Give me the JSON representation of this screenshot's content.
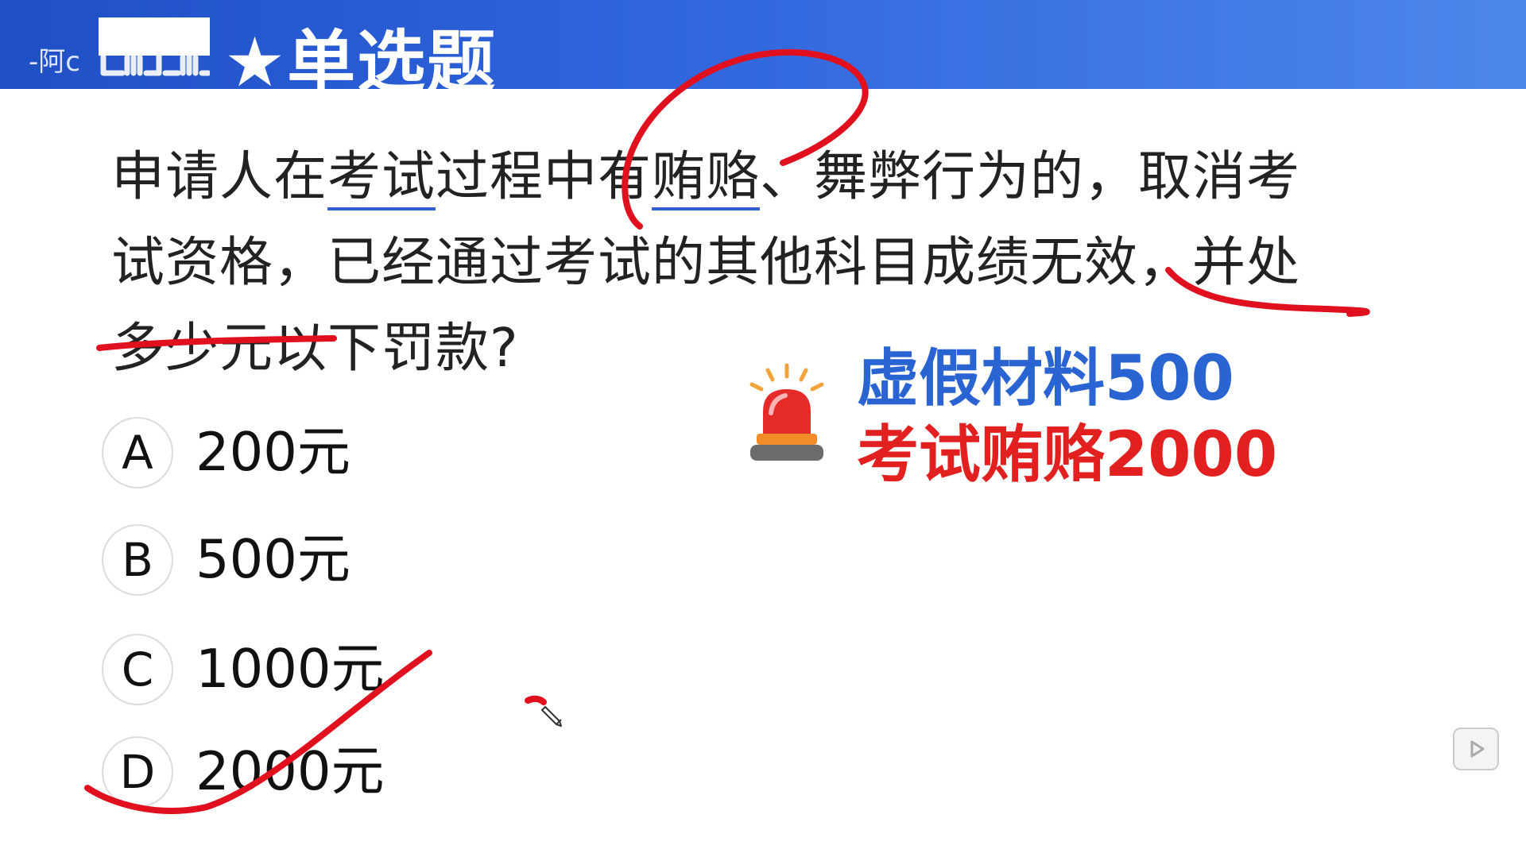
{
  "header": {
    "watermark_text": "-阿c",
    "title": "★单选题",
    "bg_color": "#2e63dc"
  },
  "question": {
    "line1_a": "申请人在",
    "line1_b": "考试",
    "line1_c": "过程中有",
    "line1_d": "贿赂",
    "line1_e": "、舞弊行为的，取消考",
    "line2": "试资格，已经通过考试的其他科目成绩无效，并处",
    "line3": "多少元以下罚款?"
  },
  "options": [
    {
      "letter": "A",
      "text": "200元"
    },
    {
      "letter": "B",
      "text": "500元"
    },
    {
      "letter": "C",
      "text": "1000元"
    },
    {
      "letter": "D",
      "text": "2000元"
    }
  ],
  "notes": {
    "line1": "虚假材料500",
    "line2": "考试贿赂2000"
  },
  "icons": {
    "alarm": "siren-icon",
    "pencil": "pencil-cursor-icon",
    "play": "play-icon"
  },
  "colors": {
    "annotation_red": "#e0101e",
    "accent_blue": "#2a64d3",
    "accent_red": "#e32020"
  }
}
